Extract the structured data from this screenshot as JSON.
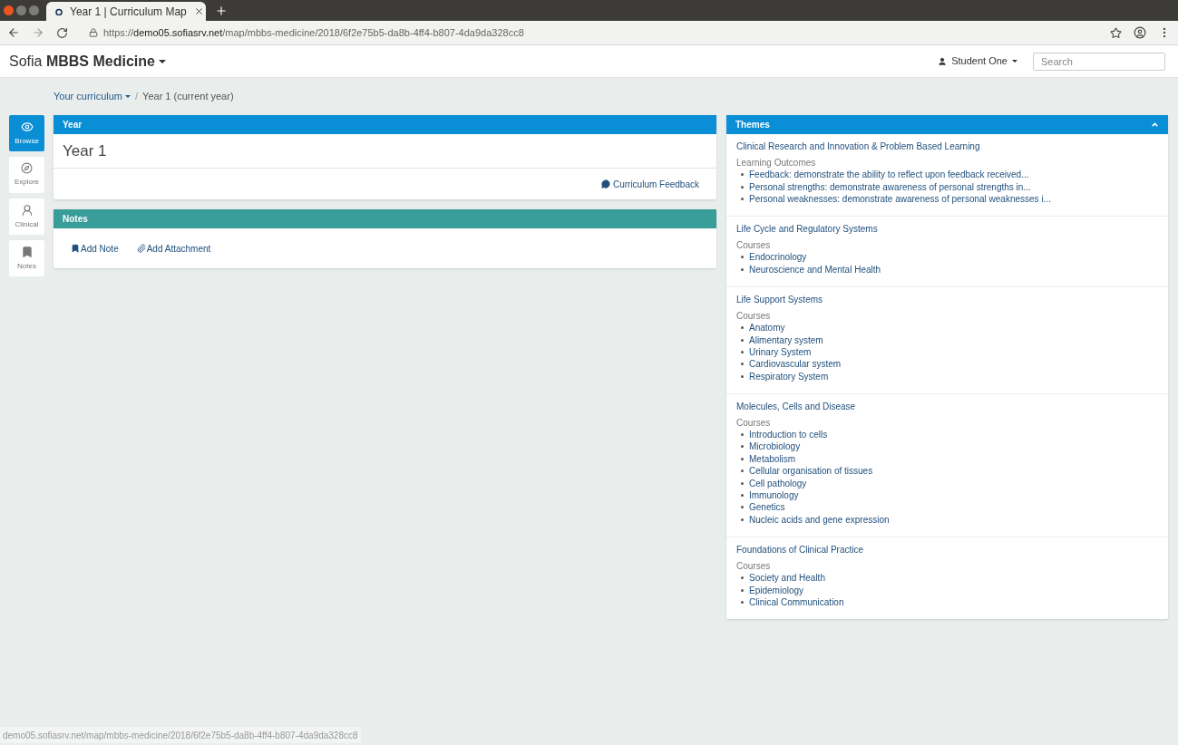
{
  "browser": {
    "tab_title": "Year 1 | Curriculum Map",
    "url_host": "demo05.sofiasrv.net",
    "url_path": "/map/mbbs-medicine/2018/6f2e75b5-da8b-4ff4-b807-4da9da328cc8",
    "https": "https://"
  },
  "navbar": {
    "brand_prefix": "Sofia",
    "brand_name": "MBBS Medicine",
    "user": "Student One",
    "search": {
      "placeholder": "Search"
    }
  },
  "breadcrumb": {
    "parent": "Your curriculum",
    "separator": "/",
    "current": "Year 1 (current year)"
  },
  "sidebar": [
    {
      "label": "Browse",
      "selected": true
    },
    {
      "label": "Explore",
      "selected": false
    },
    {
      "label": "Clinical",
      "selected": false
    },
    {
      "label": "Notes",
      "selected": false
    }
  ],
  "year_panel": {
    "header": "Year",
    "title": "Year 1",
    "feedback_link": "Curriculum Feedback"
  },
  "notes_panel": {
    "header": "Notes",
    "actions": [
      {
        "label": "Add Note"
      },
      {
        "label": "Add Attachment"
      }
    ]
  },
  "themes_panel": {
    "header": "Themes",
    "sections": [
      {
        "title": "Clinical Research and Innovation & Problem Based Learning",
        "group": "Learning Outcomes",
        "items": [
          "Feedback: demonstrate the ability to reflect upon feedback received...",
          "Personal strengths: demonstrate awareness of personal strengths in...",
          "Personal weaknesses: demonstrate awareness of personal weaknesses i..."
        ]
      },
      {
        "title": "Life Cycle and Regulatory Systems",
        "group": "Courses",
        "items": [
          "Endocrinology",
          "Neuroscience and Mental Health"
        ]
      },
      {
        "title": "Life Support Systems",
        "group": "Courses",
        "items": [
          "Anatomy",
          "Alimentary system",
          "Urinary System",
          "Cardiovascular system",
          "Respiratory System"
        ]
      },
      {
        "title": "Molecules, Cells and Disease",
        "group": "Courses",
        "items": [
          "Introduction to cells",
          "Microbiology",
          "Metabolism",
          "Cellular organisation of tissues",
          "Cell pathology",
          "Immunology",
          "Genetics",
          "Nucleic acids and gene expression"
        ]
      },
      {
        "title": "Foundations of Clinical Practice",
        "group": "Courses",
        "items": [
          "Society and Health",
          "Epidemiology",
          "Clinical Communication"
        ]
      }
    ]
  },
  "status_bar": {
    "url": "demo05.sofiasrv.net/map/mbbs-medicine/2018/6f2e75b5-da8b-4ff4-b807-4da9da328cc8"
  }
}
